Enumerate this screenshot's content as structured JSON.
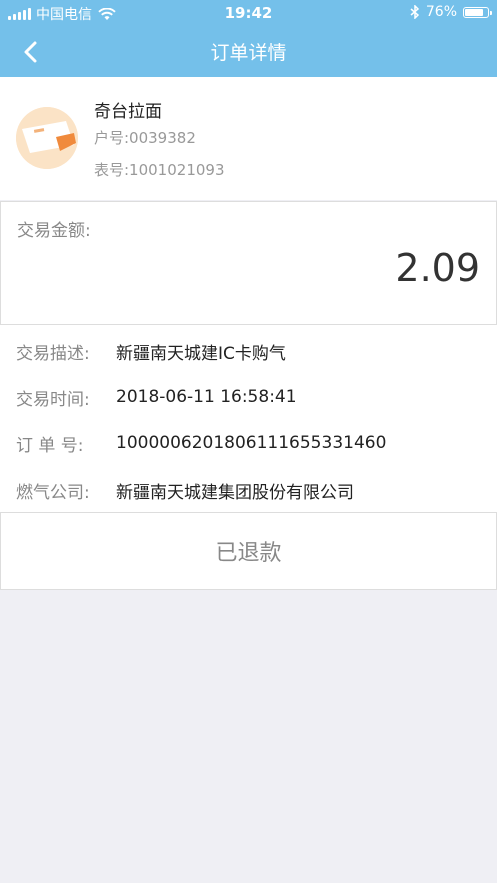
{
  "status_bar": {
    "carrier": "中国电信",
    "time": "19:42",
    "battery": "76%",
    "battery_level": 0.76
  },
  "nav": {
    "title": "订单详情"
  },
  "merchant": {
    "name": "奇台拉面",
    "account": "户号:0039382",
    "meter": "表号:1001021093"
  },
  "amount": {
    "label": "交易金额:",
    "value": "2.09"
  },
  "details": [
    {
      "label": "交易描述:",
      "value": "新疆南天城建IC卡购气"
    },
    {
      "label": "交易时间:",
      "value": "2018-06-11 16:58:41"
    },
    {
      "label": "订 单 号:",
      "value": "1000006201806111655331460"
    },
    {
      "label": "燃气公司:",
      "value": "新疆南天城建集团股份有限公司"
    }
  ],
  "status": {
    "text": "已退款"
  },
  "colors": {
    "header": "#74c0ea",
    "background": "#efeff4"
  },
  "icons": {
    "back": "chevron-left-icon",
    "signal": "cellular-signal-icon",
    "wifi": "wifi-icon",
    "bluetooth": "bluetooth-icon",
    "battery": "battery-icon"
  }
}
